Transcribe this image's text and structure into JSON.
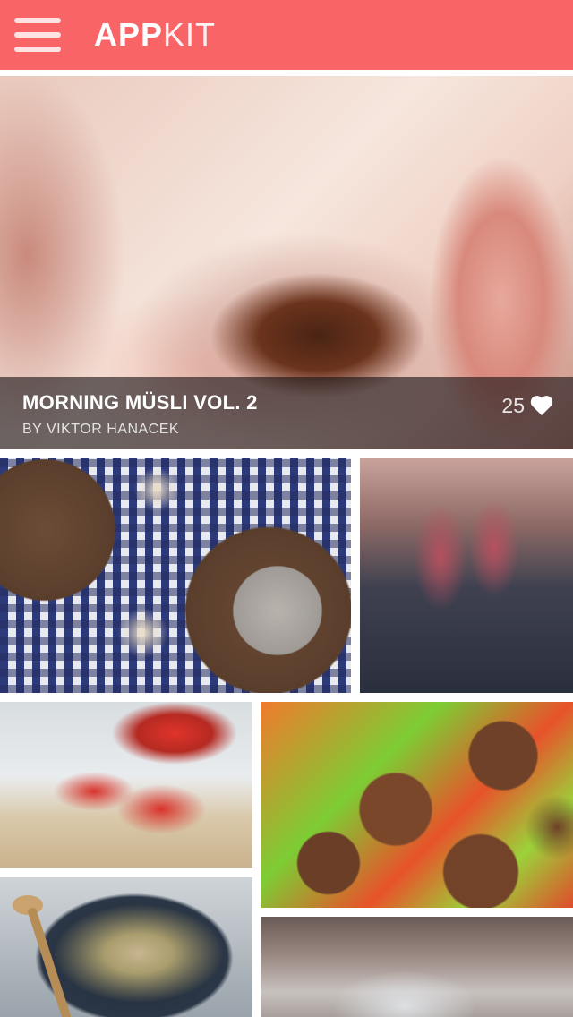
{
  "app": {
    "brand_bold": "APP",
    "brand_light": "KIT",
    "menu_icon": "hamburger-menu-icon",
    "header_color": "#f96466"
  },
  "hero": {
    "title": "MORNING MÜSLI VOL. 2",
    "author": "BY VIKTOR HANACEK",
    "likes": "25",
    "like_icon": "heart-icon"
  },
  "gallery": {
    "tiles": [
      {
        "name": "breakfast-muesli-photo"
      },
      {
        "name": "red-wine-glasses-photo"
      },
      {
        "name": "strawberries-photo"
      },
      {
        "name": "chocolate-muffins-photo"
      },
      {
        "name": "vegetable-wok-photo"
      },
      {
        "name": "glassware-photo"
      }
    ]
  }
}
